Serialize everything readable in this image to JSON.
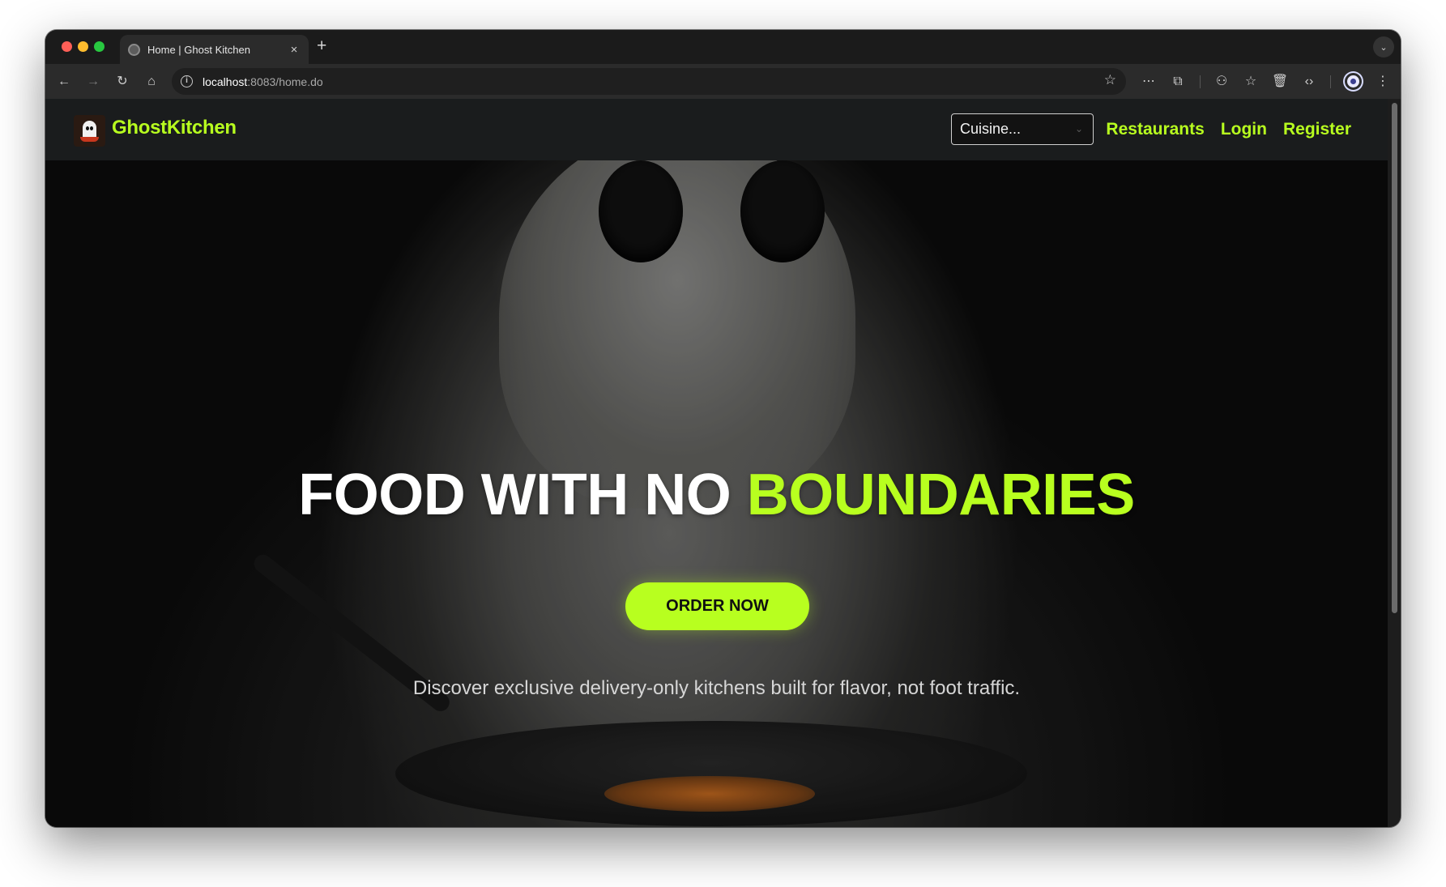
{
  "browser": {
    "tab": {
      "title": "Home | Ghost Kitchen",
      "close_icon": "×"
    },
    "new_tab_icon": "+",
    "tab_menu_icon": "⌄",
    "address": {
      "host": "localhost",
      "rest": ":8083/home.do"
    },
    "toolbar_icons": {
      "back": "←",
      "forward": "→",
      "reload": "↻",
      "home": "⌂",
      "bookmark": "☆",
      "more_ext": "⋯",
      "extensions": "⧉",
      "ext_a": "⚇",
      "ext_b": "☆",
      "ext_c": "🗑",
      "ext_d": "‹›",
      "menu": "⋮"
    }
  },
  "navbar": {
    "brand": "GhostKitchen",
    "cuisine_select": {
      "selected": "Cuisine..."
    },
    "links": [
      "Restaurants",
      "Login",
      "Register"
    ]
  },
  "hero": {
    "title_main": "FOOD WITH NO ",
    "title_accent": "BOUNDARIES",
    "cta": "ORDER NOW",
    "subtitle": "Discover exclusive delivery-only kitchens built for flavor, not foot traffic."
  },
  "colors": {
    "accent": "#b8ff1f",
    "navbar_bg": "#1a1c1d",
    "browser_chrome": "#2b2b2b"
  }
}
